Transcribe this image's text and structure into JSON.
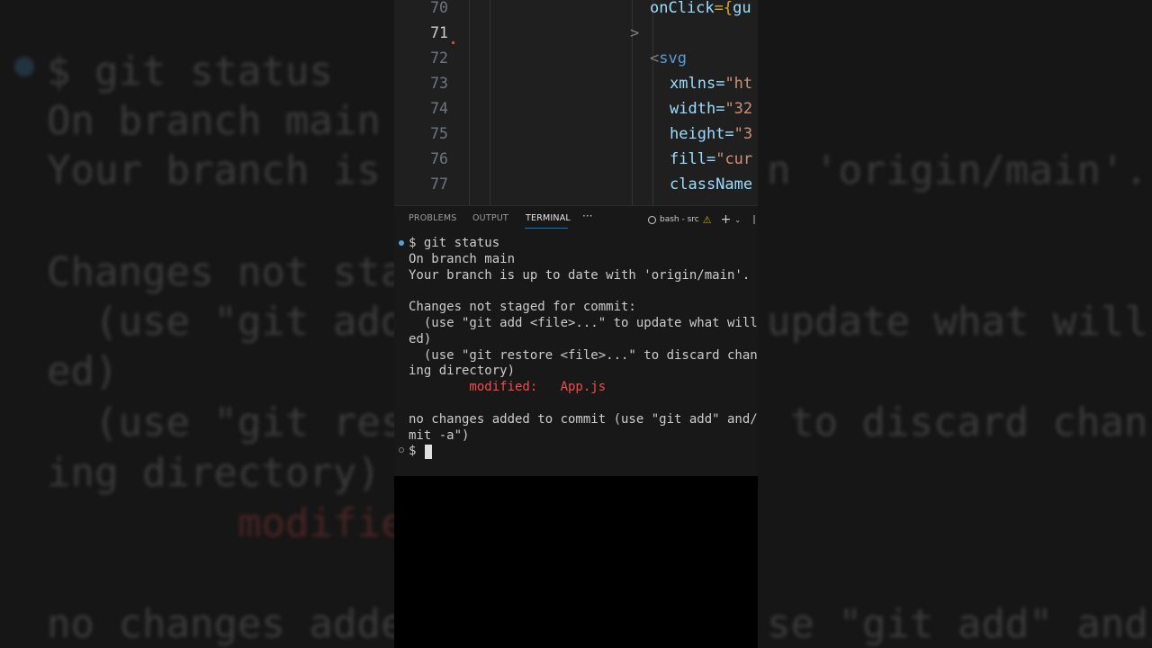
{
  "background": {
    "lines": [
      "$ git status",
      "On branch main",
      "Your branch is",
      "n 'origin/main'.",
      "Changes not sta",
      "  (use \"git add",
      "update what will",
      "ed)",
      "  (use \"git res",
      "to discard chan",
      "ing directory)",
      "modifie",
      "no changes adde",
      "se \"git add\" and/"
    ]
  },
  "editor": {
    "line_numbers": [
      "70",
      "71",
      "72",
      "73",
      "74",
      "75",
      "76",
      "77"
    ],
    "lines": [
      {
        "attr": "onClick",
        "punc": "={",
        "val": "gu"
      },
      {
        "gray": ">"
      },
      {
        "punc": "<",
        "tag": "svg"
      },
      {
        "attr": "xmlns",
        "punc": "=",
        "val": "\"ht"
      },
      {
        "attr": "width",
        "punc": "=",
        "val": "\"32"
      },
      {
        "attr": "height",
        "punc": "=",
        "val": "\"3"
      },
      {
        "attr": "fill",
        "punc": "=",
        "val": "\"cur"
      },
      {
        "attr": "className"
      }
    ]
  },
  "panel": {
    "tabs": [
      "PROBLEMS",
      "OUTPUT",
      "TERMINAL"
    ],
    "active_tab": "TERMINAL",
    "more": "···",
    "terminal_name": "bash - src",
    "warn_glyph": "⚠",
    "add_glyph": "+",
    "chevron_glyph": "⌄"
  },
  "terminal": {
    "lines": [
      "$ git status",
      "On branch main",
      "Your branch is up to date with 'origin/main'.",
      "",
      "Changes not staged for commit:",
      "  (use \"git add <file>...\" to update what will",
      "ed)",
      "  (use \"git restore <file>...\" to discard chan",
      "ing directory)",
      "        modified:   App.js",
      "",
      "no changes added to commit (use \"git add\" and/",
      "mit -a\")",
      "$ "
    ]
  },
  "colors": {
    "terminal_text": "#cccccc",
    "modified": "#f14c4c",
    "accent": "#0078d4",
    "string": "#ce9178",
    "attribute": "#9cdcfe",
    "tag": "#569cd6"
  }
}
